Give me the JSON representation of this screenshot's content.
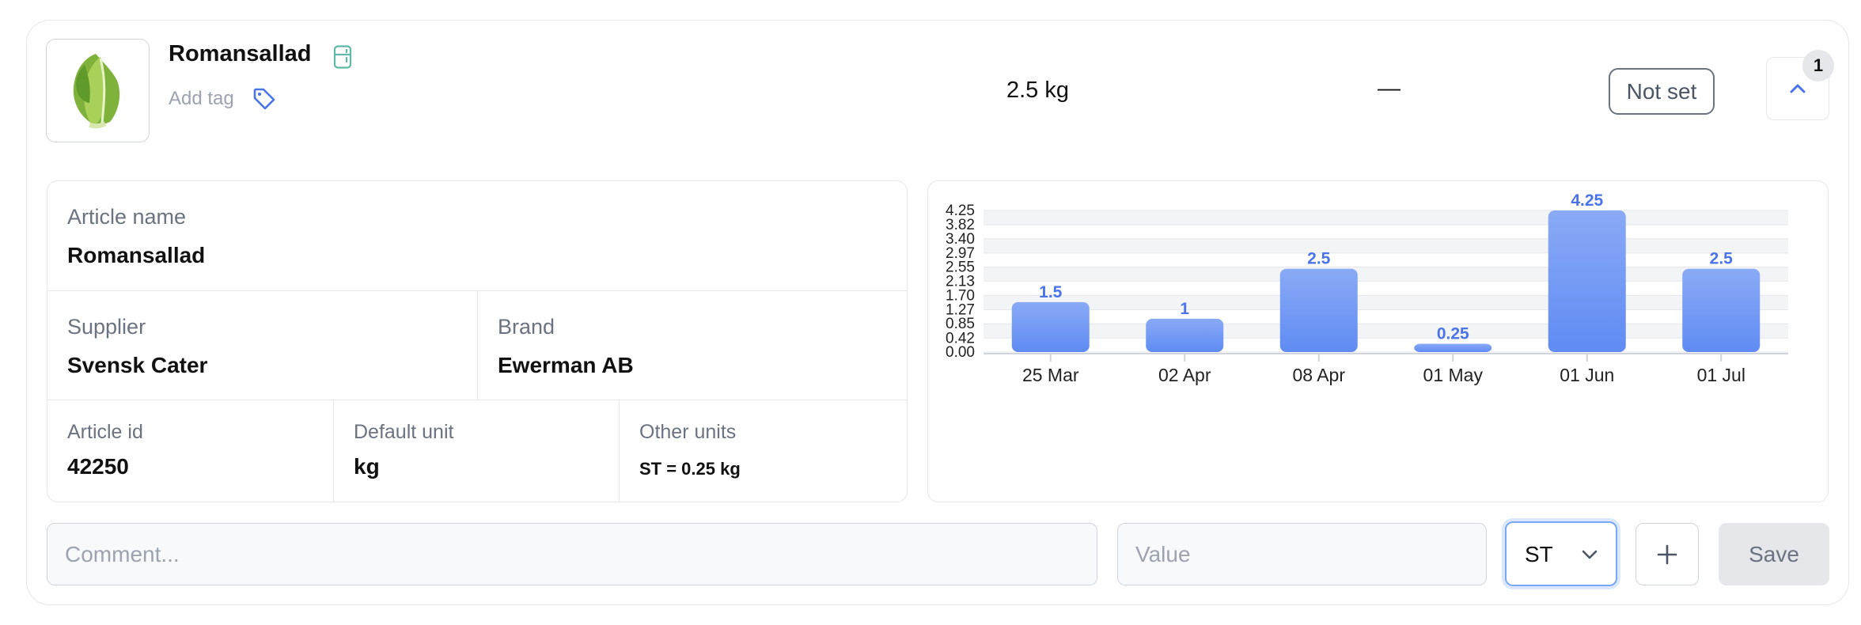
{
  "product": {
    "title": "Romansallad",
    "add_tag_label": "Add tag",
    "quantity": "2.5 kg",
    "dash": "—",
    "status_button": "Not set",
    "count_badge": "1"
  },
  "details": {
    "article_name_label": "Article name",
    "article_name": "Romansallad",
    "supplier_label": "Supplier",
    "supplier": "Svensk Cater",
    "brand_label": "Brand",
    "brand": "Ewerman AB",
    "article_id_label": "Article id",
    "article_id": "42250",
    "default_unit_label": "Default unit",
    "default_unit": "kg",
    "other_units_label": "Other units",
    "other_units": "ST = 0.25 kg"
  },
  "chart_data": {
    "type": "bar",
    "categories": [
      "25 Mar",
      "02 Apr",
      "08 Apr",
      "01 May",
      "01 Jun",
      "01 Jul"
    ],
    "values": [
      1.5,
      1,
      2.5,
      0.25,
      4.25,
      2.5
    ],
    "value_labels": [
      "1.5",
      "1",
      "2.5",
      "0.25",
      "4.25",
      "2.5"
    ],
    "y_ticks": [
      "0.00",
      "0.42",
      "0.85",
      "1.27",
      "1.70",
      "2.13",
      "2.55",
      "2.97",
      "3.40",
      "3.82",
      "4.25"
    ],
    "ylim": [
      0,
      4.25
    ],
    "grid": true,
    "bar_color": "#6b93f5",
    "label_color": "#4a74e8"
  },
  "form": {
    "comment_placeholder": "Comment...",
    "value_placeholder": "Value",
    "unit_selected": "ST",
    "save_label": "Save"
  },
  "colors": {
    "accent": "#4a74e8",
    "fridge_icon": "#5fb8a8"
  },
  "icons": {
    "fridge": "fridge-icon",
    "tag": "tag-icon",
    "collapse": "chevron-up-icon",
    "unit_dropdown": "chevron-down-icon",
    "add": "plus-icon"
  }
}
